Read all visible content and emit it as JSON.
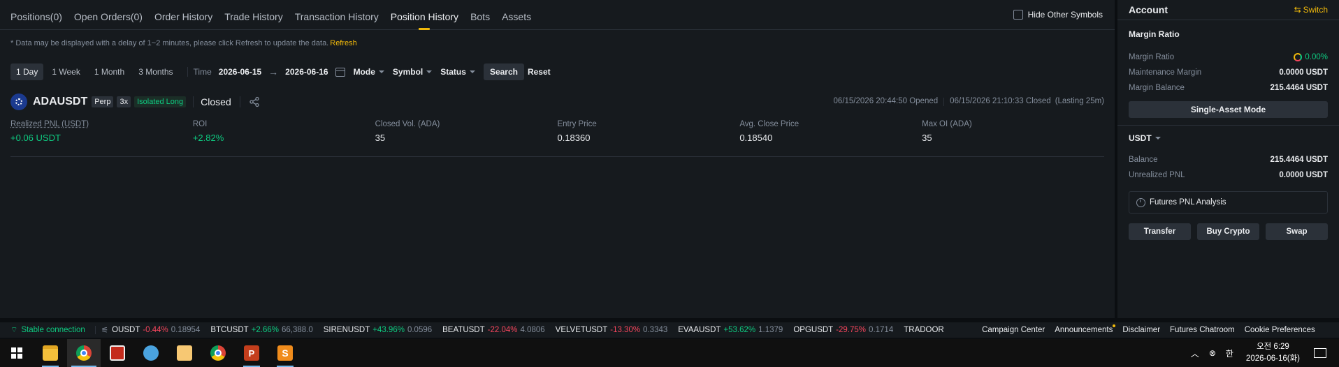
{
  "tabs": [
    {
      "label": "Positions(0)",
      "active": false
    },
    {
      "label": "Open Orders(0)",
      "active": false
    },
    {
      "label": "Order History",
      "active": false
    },
    {
      "label": "Trade History",
      "active": false
    },
    {
      "label": "Transaction History",
      "active": false
    },
    {
      "label": "Position History",
      "active": true
    },
    {
      "label": "Bots",
      "active": false
    },
    {
      "label": "Assets",
      "active": false
    }
  ],
  "hide_other_symbols": "Hide Other Symbols",
  "notice": {
    "text": "* Data may be displayed with a delay of 1~2 minutes, please click Refresh to update the data.",
    "refresh": "Refresh"
  },
  "filters": {
    "ranges": [
      "1 Day",
      "1 Week",
      "1 Month",
      "3 Months"
    ],
    "time_label": "Time",
    "date_from": "2026-06-15",
    "date_to": "2026-06-16",
    "mode": "Mode",
    "symbol": "Symbol",
    "status": "Status",
    "search": "Search",
    "reset": "Reset"
  },
  "position": {
    "symbol": "ADAUSDT",
    "type": "Perp",
    "leverage": "3x",
    "margin_side": "Isolated Long",
    "status": "Closed",
    "opened": "06/15/2026 20:44:50 Opened",
    "closed": "06/15/2026 21:10:33 Closed",
    "lasting": "(Lasting 25m)",
    "metrics": [
      {
        "label": "Realized PNL (USDT)",
        "value": "+0.06 USDT",
        "green": true,
        "underline": true
      },
      {
        "label": "ROI",
        "value": "+2.82%",
        "green": true,
        "underline": false
      },
      {
        "label": "Closed Vol. (ADA)",
        "value": "35",
        "green": false,
        "underline": false
      },
      {
        "label": "Entry Price",
        "value": "0.18360",
        "green": false,
        "underline": false
      },
      {
        "label": "Avg. Close Price",
        "value": "0.18540",
        "green": false,
        "underline": false
      },
      {
        "label": "Max OI (ADA)",
        "value": "35",
        "green": false,
        "underline": false
      }
    ]
  },
  "account": {
    "title": "Account",
    "switch": "Switch",
    "margin_section": "Margin Ratio",
    "margin_ratio_label": "Margin Ratio",
    "margin_ratio_value": "0.00%",
    "maintenance_label": "Maintenance Margin",
    "maintenance_value": "0.0000 USDT",
    "margin_balance_label": "Margin Balance",
    "margin_balance_value": "215.4464 USDT",
    "single_asset_mode": "Single-Asset Mode",
    "currency": "USDT",
    "balance_label": "Balance",
    "balance_value": "215.4464 USDT",
    "unrealized_label": "Unrealized PNL",
    "unrealized_value": "0.0000 USDT",
    "pnl_analysis": "Futures PNL Analysis",
    "transfer": "Transfer",
    "buy_crypto": "Buy Crypto",
    "swap": "Swap"
  },
  "ticker": {
    "connection": "Stable connection",
    "items": [
      {
        "name": "OUSDT",
        "change": "-0.44%",
        "up": false,
        "price": "0.18954"
      },
      {
        "name": "BTCUSDT",
        "change": "+2.66%",
        "up": true,
        "price": "66,388.0"
      },
      {
        "name": "SIRENUSDT",
        "change": "+43.96%",
        "up": true,
        "price": "0.0596"
      },
      {
        "name": "BEATUSDT",
        "change": "-22.04%",
        "up": false,
        "price": "4.0806"
      },
      {
        "name": "VELVETUSDT",
        "change": "-13.30%",
        "up": false,
        "price": "0.3343"
      },
      {
        "name": "EVAAUSDT",
        "change": "+53.62%",
        "up": true,
        "price": "1.1379"
      },
      {
        "name": "OPGUSDT",
        "change": "-29.75%",
        "up": false,
        "price": "0.1714"
      },
      {
        "name": "TRADOOR",
        "change": "",
        "up": true,
        "price": ""
      }
    ],
    "links": [
      "Campaign Center",
      "Announcements",
      "Disclaimer",
      "Futures Chatroom",
      "Cookie Preferences"
    ]
  },
  "taskbar": {
    "time": "오전 6:29",
    "date": "2026-06-16(화)",
    "ime": "한"
  },
  "colors": {
    "accent": "#f0b90b",
    "up": "#0ecb81",
    "down": "#f6465d",
    "bg": "#161a1e"
  }
}
